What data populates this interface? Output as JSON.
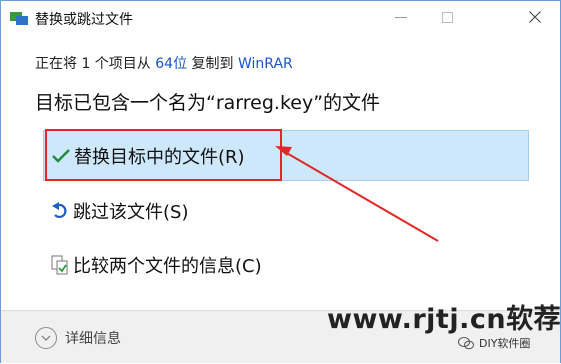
{
  "window": {
    "title": "替换或跳过文件"
  },
  "status": {
    "prefix": "正在将 1 个项目从 ",
    "source": "64位",
    "middle": " 复制到 ",
    "destination": "WinRAR"
  },
  "heading": "目标已包含一个名为“rarreg.key”的文件",
  "options": [
    {
      "label": "替换目标中的文件(R)",
      "icon": "check-icon"
    },
    {
      "label": "跳过该文件(S)",
      "icon": "undo-arrow-icon"
    },
    {
      "label": "比较两个文件的信息(C)",
      "icon": "compare-files-icon"
    }
  ],
  "footer": {
    "details_label": "详细信息"
  },
  "watermark": {
    "main": "www.rjtj.cn软荐网",
    "sub": "DIY软件圈"
  },
  "colors": {
    "selected_bg": "#cde8fb",
    "link": "#1a56c8",
    "annotation": "#e02828"
  }
}
